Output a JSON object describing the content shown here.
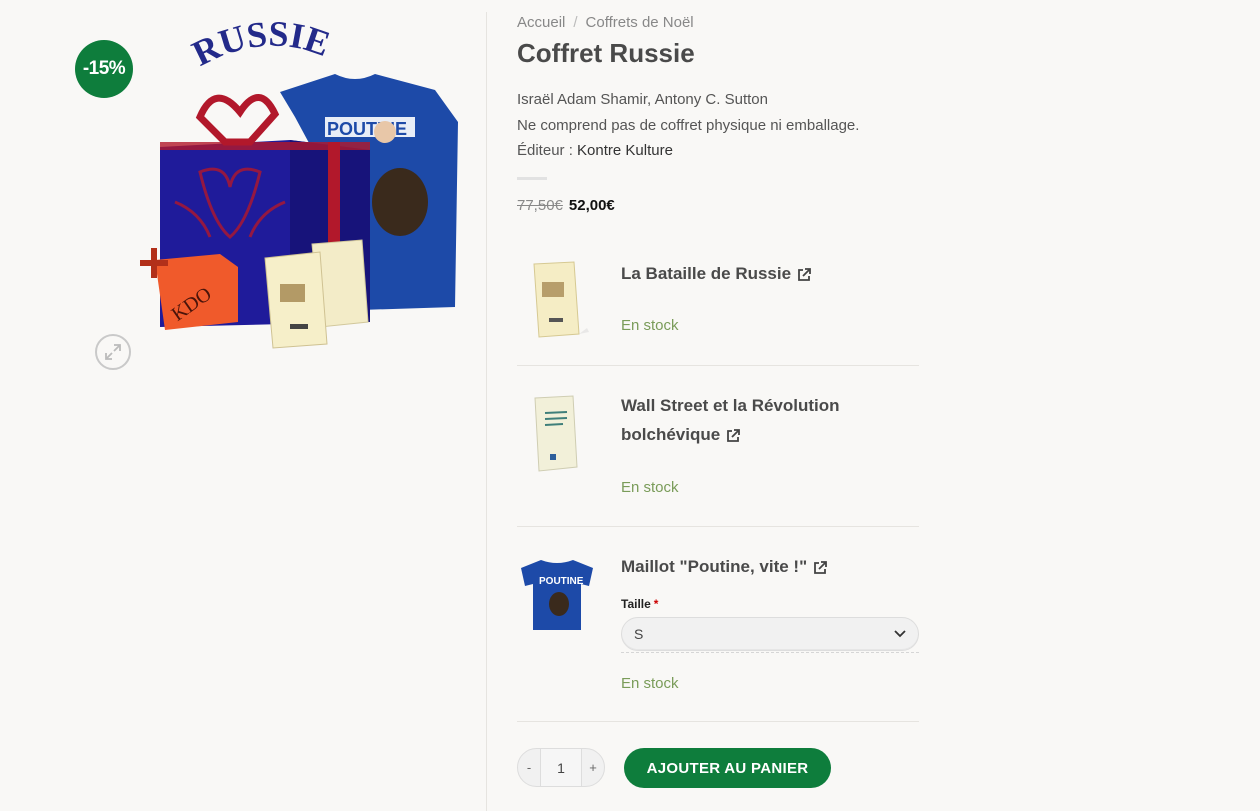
{
  "gallery": {
    "sale_badge": "-15%",
    "hero_title": "RUSSIE",
    "hero_shirt_text": "POUTINE",
    "hero_gift_tag": "KDO"
  },
  "breadcrumb": {
    "home": "Accueil",
    "separator": "/",
    "category": "Coffrets de Noël"
  },
  "product": {
    "title": "Coffret Russie",
    "authors": "Israël Adam Shamir, Antony C. Sutton",
    "note": "Ne comprend pas de coffret physique ni emballage.",
    "editor_label": "Éditeur :",
    "editor_name": "Kontre Kulture"
  },
  "price": {
    "regular": "77,50€",
    "sale": "52,00€"
  },
  "bundle": {
    "items": [
      {
        "name": "La Bataille de Russie",
        "stock": "En stock",
        "thumb_icon": "book-thumbnail"
      },
      {
        "name_line1": "Wall Street et la Révolution",
        "name_line2": "bolchévique",
        "stock": "En stock",
        "thumb_icon": "book-thumbnail"
      },
      {
        "name": "Maillot \"Poutine, vite !\"",
        "stock": "En stock",
        "thumb_icon": "tshirt-thumbnail",
        "thumb_text": "POUTINE",
        "size_label": "Taille",
        "required_mark": "*",
        "size_value": "S"
      }
    ]
  },
  "cart": {
    "quantity": "1",
    "minus": "-",
    "plus": "+",
    "add_label": "AJOUTER AU PANIER"
  },
  "colors": {
    "accent_green": "#0e7d3c",
    "stock_green": "#7a9c59",
    "shirt_blue": "#1d4aa8"
  }
}
